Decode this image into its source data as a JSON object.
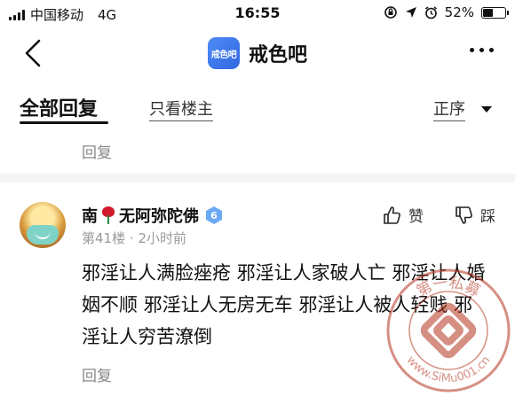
{
  "status_bar": {
    "carrier": "中国移动",
    "network": "4G",
    "time": "16:55",
    "battery": "52%",
    "battery_level": 0.52
  },
  "nav": {
    "logo_text": "戒色吧",
    "title": "戒色吧"
  },
  "tabs": {
    "all_replies": "全部回复",
    "owner_only": "只看楼主",
    "sort": "正序"
  },
  "previous_reply_label": "回复",
  "post": {
    "username_prefix": "南",
    "username_suffix": "无阿弥陀佛",
    "level": "6",
    "floor": "第41楼",
    "separator": "·",
    "time": "2小时前",
    "like_label": "赞",
    "dislike_label": "踩",
    "content": "邪淫让人满脸痤疮 邪淫让人家破人亡 邪淫让人婚姻不顺 邪淫让人无房无车 邪淫让人被人轻贱 邪淫让人穷苦潦倒",
    "reply_label": "回复"
  },
  "watermark": {
    "text_top": "第一私募",
    "text_bottom": "www.SiMu001.cn"
  }
}
